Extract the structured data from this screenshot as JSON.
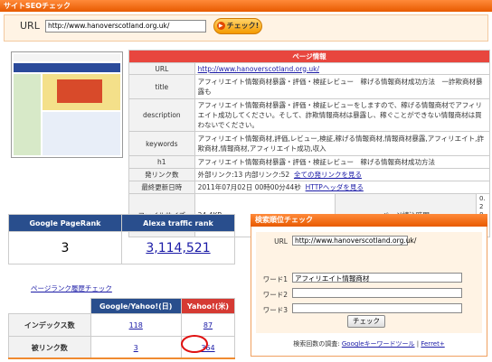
{
  "header": {
    "title": "サイトSEOチェック"
  },
  "url_form": {
    "label": "URL",
    "value": "http://www.hanoverscotland.org.uk/",
    "button": "チェック!"
  },
  "page_info": {
    "caption": "ページ情報",
    "rows": {
      "url": {
        "label": "URL",
        "value": "http://www.hanoverscotland.org.uk/"
      },
      "title": {
        "label": "title",
        "value": "アフィリエイト情報商材暴露・評価・検証レビュー　稼げる情報商材成功方法　一詐欺商材暴露も"
      },
      "description": {
        "label": "description",
        "value": "アフィリエイト情報商材暴露・評価・検証レビューをしますので、稼げる情報商材でアフィリエイト成功してください。そして、詐欺情報商材は暴露し、稼ぐことができない情報商材は買わないでください。"
      },
      "keywords": {
        "label": "keywords",
        "value": "アフィリエイト情報商材,評価,レビュー,検証,稼げる情報商材,情報商材暴露,アフィリエイト,詐欺商材,情報商材,アフィリエイト成功,収入"
      },
      "h1": {
        "label": "h1",
        "value": "アフィリエイト情報商材暴露・評価・検証レビュー　稼げる情報商材成功方法"
      },
      "links": {
        "label": "発リンク数",
        "value": "外部リンク:13  内部リンク:52",
        "link": "全ての発リンクを見る"
      },
      "updated": {
        "label": "最終更新日時",
        "value": "2011年07月02日  00時00分44秒",
        "link": "HTTPヘッダを見る"
      },
      "filesize": {
        "label": "ファイルサイズ",
        "value": "24.4KB",
        "load_label": "ページ読込時間",
        "load_value": "0.282秒"
      }
    }
  },
  "pagerank": {
    "pr_header": "Google PageRank",
    "alexa_header": "Alexa traffic rank",
    "pr_value": "3",
    "alexa_value": "3,114,521",
    "history_link": "ページランク履歴チェック"
  },
  "index_table": {
    "col_google": "Google/Yahoo!(日)",
    "col_yahoo": "Yahoo!(米)",
    "row_index": {
      "label": "インデックス数",
      "google": "118",
      "yahoo": "87"
    },
    "row_backlinks": {
      "label": "被リンク数",
      "google": "3",
      "yahoo": "364"
    }
  },
  "rank_check": {
    "title": "検索順位チェック",
    "url_label": "URL",
    "url_value": "http://www.hanoverscotland.org.uk/",
    "word1_label": "ワード1",
    "word1_value": "アフィリエイト情報商材",
    "word2_label": "ワード2",
    "word2_value": "",
    "word3_label": "ワード3",
    "word3_value": "",
    "button": "チェック",
    "note_prefix": "検索回数の調査:",
    "note_link1": "Googleキーワードツール",
    "note_sep": " | ",
    "note_link2": "Ferret+"
  },
  "colors": {
    "accent_orange": "#f07a20",
    "header_red": "#e8463e",
    "navy": "#294e8d",
    "annotation": "#e01010"
  }
}
